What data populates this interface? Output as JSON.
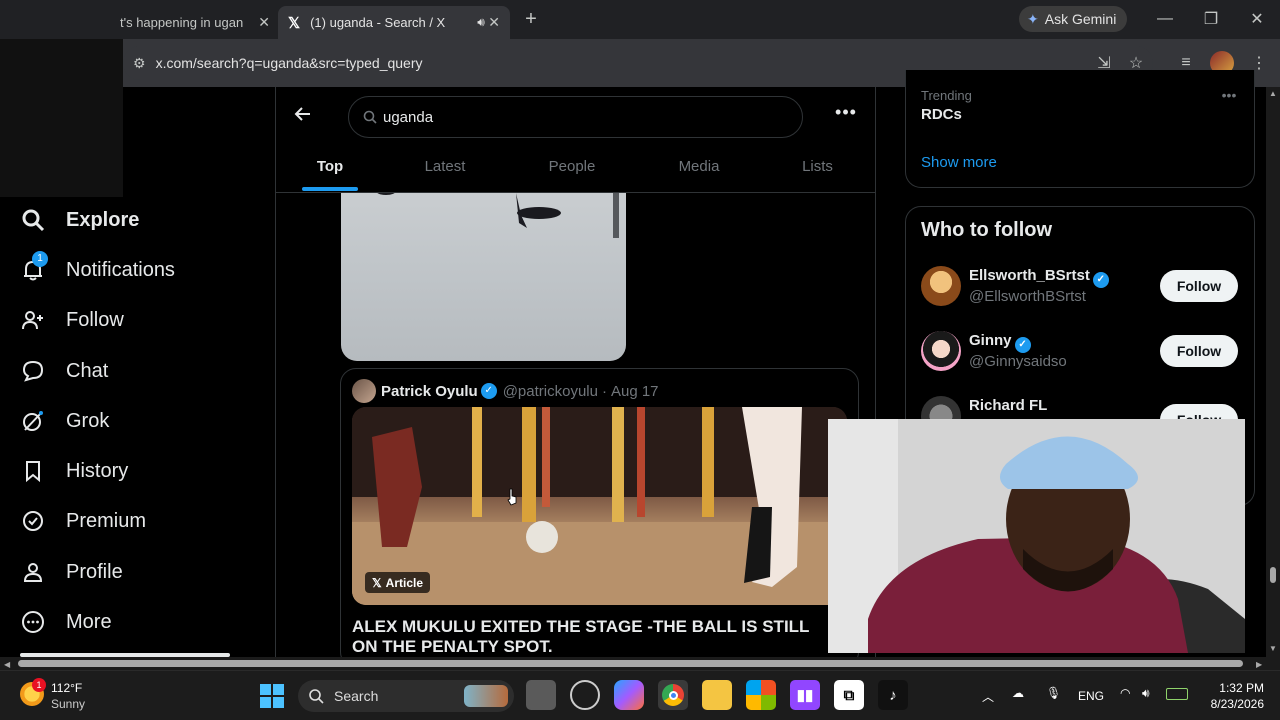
{
  "browser": {
    "tabs": [
      {
        "title": "t's happening in ugan",
        "active": false
      },
      {
        "title": "(1) uganda - Search / X",
        "active": true
      }
    ],
    "new_tab": "+",
    "ask_gemini": "Ask Gemini",
    "url": "x.com/search?q=uganda&src=typed_query"
  },
  "nav": {
    "items": [
      {
        "label": "Explore",
        "icon": "search-icon"
      },
      {
        "label": "Notifications",
        "icon": "bell-icon",
        "badge": "1"
      },
      {
        "label": "Follow",
        "icon": "add-person-icon"
      },
      {
        "label": "Chat",
        "icon": "chat-bubble-icon"
      },
      {
        "label": "Grok",
        "icon": "grok-icon"
      },
      {
        "label": "History",
        "icon": "bookmark-icon"
      },
      {
        "label": "Premium",
        "icon": "verified-badge-icon"
      },
      {
        "label": "Profile",
        "icon": "person-icon"
      },
      {
        "label": "More",
        "icon": "more-circle-icon"
      }
    ]
  },
  "search": {
    "query": "uganda",
    "tabs": [
      "Top",
      "Latest",
      "People",
      "Media",
      "Lists"
    ],
    "active_tab": "Top"
  },
  "quoted_post": {
    "author": "Patrick Oyulu",
    "handle": "@patrickoyulu",
    "sep": "·",
    "date": "Aug 17",
    "badge": "Article",
    "headline": "ALEX MUKULU EXITED THE STAGE -THE BALL IS STILL ON THE PENALTY SPOT."
  },
  "trending": {
    "label": "Trending",
    "topic": "RDCs",
    "show_more": "Show more"
  },
  "who_to_follow": {
    "title": "Who to follow",
    "accounts": [
      {
        "name": "Ellsworth_BSrtst",
        "handle": "@EllsworthBSrtst",
        "button": "Follow"
      },
      {
        "name": "Ginny",
        "handle": "@Ginnysaidso",
        "button": "Follow"
      },
      {
        "name": "Richard FL",
        "handle": "",
        "button": "Follow"
      }
    ]
  },
  "taskbar": {
    "weather_temp": "112°F",
    "weather_desc": "Sunny",
    "weather_badge": "1",
    "search_label": "Search",
    "language": "ENG",
    "time": "1:32 PM",
    "date": "8/23/2026"
  },
  "colors": {
    "accent": "#1d9bf0",
    "background": "#000000",
    "text": "#e7e9ea",
    "muted": "#71767b"
  }
}
